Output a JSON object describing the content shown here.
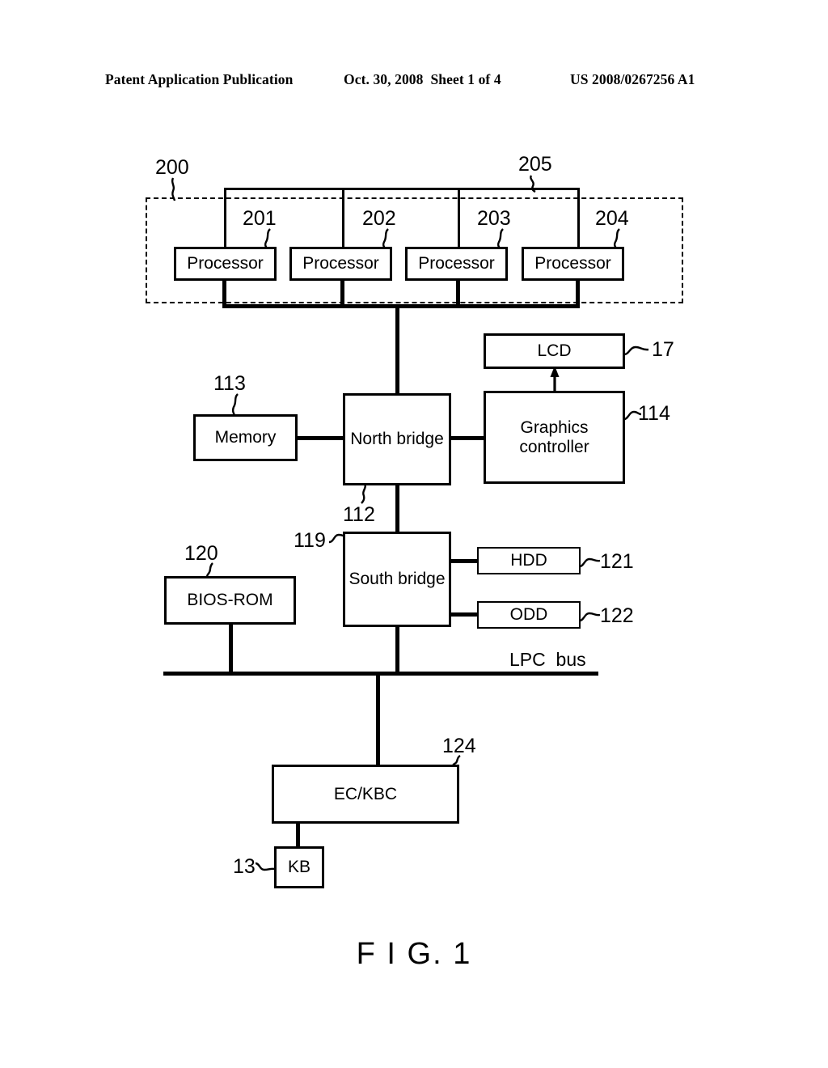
{
  "header": {
    "publication": "Patent Application Publication",
    "date_sheet": "Oct. 30, 2008  Sheet 1 of 4",
    "patent_number": "US 2008/0267256 A1"
  },
  "figure": {
    "caption": "F I G. 1",
    "bus_label": "LPC  bus"
  },
  "blocks": {
    "processor1": "Processor",
    "processor2": "Processor",
    "processor3": "Processor",
    "processor4": "Processor",
    "memory": "Memory",
    "north_bridge": "North  bridge",
    "south_bridge": "South  bridge",
    "lcd": "LCD",
    "graphics_controller": "Graphics\ncontroller",
    "bios_rom": "BIOS-ROM",
    "hdd": "HDD",
    "odd": "ODD",
    "ec_kbc": "EC/KBC",
    "kb": "KB"
  },
  "refs": {
    "cpu_group": "200",
    "cpu_bus": "205",
    "processor1": "201",
    "processor2": "202",
    "processor3": "203",
    "processor4": "204",
    "memory": "113",
    "north_bridge": "112",
    "south_bridge": "119",
    "lcd": "17",
    "graphics_controller": "114",
    "bios_rom": "120",
    "hdd": "121",
    "odd": "122",
    "ec_kbc": "124",
    "kb": "13"
  },
  "colors": {
    "ink": "#000000",
    "paper": "#ffffff"
  }
}
